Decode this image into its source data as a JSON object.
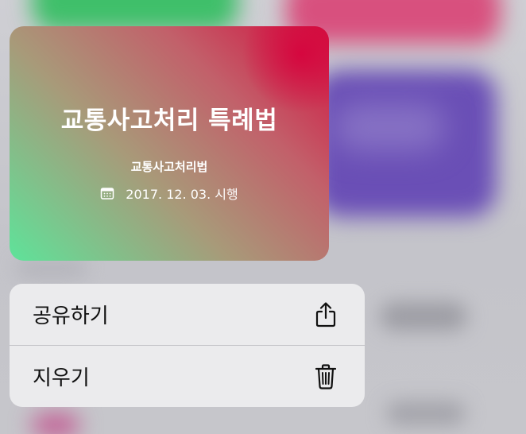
{
  "card": {
    "title": "교통사고처리 특례법",
    "subtitle": "교통사고처리법",
    "date_text": "2017. 12. 03. 시행",
    "date_icon": "calendar-icon",
    "gradient_colors": [
      "#5ee39a",
      "#a89a79",
      "#c2606a",
      "#d2103f"
    ]
  },
  "menu": {
    "items": [
      {
        "label": "공유하기",
        "icon": "share-icon"
      },
      {
        "label": "지우기",
        "icon": "trash-icon"
      }
    ]
  }
}
